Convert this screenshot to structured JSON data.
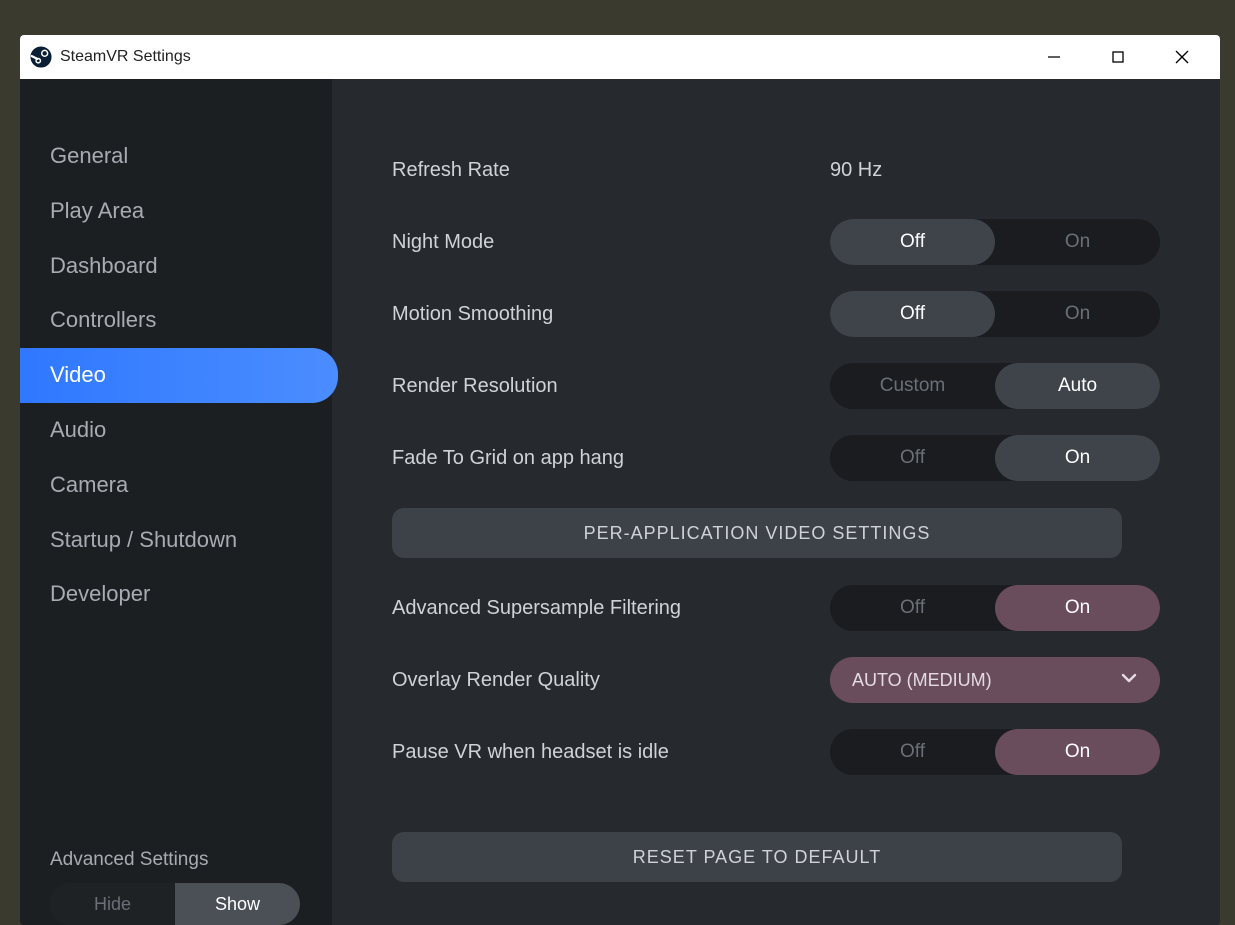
{
  "window": {
    "title": "SteamVR Settings"
  },
  "sidebar": {
    "items": [
      {
        "label": "General"
      },
      {
        "label": "Play Area"
      },
      {
        "label": "Dashboard"
      },
      {
        "label": "Controllers"
      },
      {
        "label": "Video"
      },
      {
        "label": "Audio"
      },
      {
        "label": "Camera"
      },
      {
        "label": "Startup / Shutdown"
      },
      {
        "label": "Developer"
      }
    ],
    "active_index": 4,
    "advanced_label": "Advanced Settings",
    "advanced_toggle": {
      "hide": "Hide",
      "show": "Show",
      "selected": "Show"
    }
  },
  "settings": {
    "refresh_rate": {
      "label": "Refresh Rate",
      "value": "90 Hz"
    },
    "night_mode": {
      "label": "Night Mode",
      "off": "Off",
      "on": "On",
      "selected": "Off"
    },
    "motion_smoothing": {
      "label": "Motion Smoothing",
      "off": "Off",
      "on": "On",
      "selected": "Off"
    },
    "render_resolution": {
      "label": "Render Resolution",
      "custom": "Custom",
      "auto": "Auto",
      "selected": "Auto"
    },
    "fade_to_grid": {
      "label": "Fade To Grid on app hang",
      "off": "Off",
      "on": "On",
      "selected": "On"
    },
    "per_app_button": "PER-APPLICATION VIDEO SETTINGS",
    "supersample": {
      "label": "Advanced Supersample Filtering",
      "off": "Off",
      "on": "On",
      "selected": "On"
    },
    "overlay_quality": {
      "label": "Overlay Render Quality",
      "value": "AUTO (MEDIUM)"
    },
    "pause_idle": {
      "label": "Pause VR when headset is idle",
      "off": "Off",
      "on": "On",
      "selected": "On"
    },
    "reset_button": "RESET PAGE TO DEFAULT"
  }
}
